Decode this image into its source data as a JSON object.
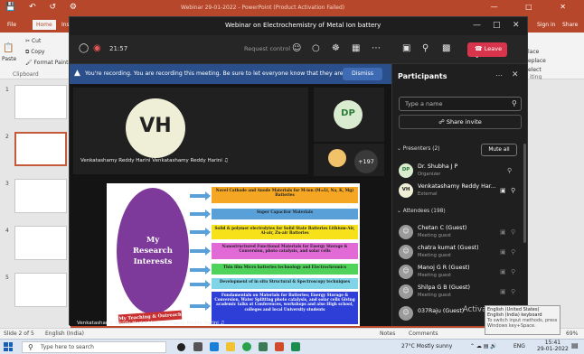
{
  "powerpoint": {
    "title": "Webinar 29-01-2022 - PowerPoint (Product Activation Failed)",
    "tabs": [
      "File",
      "Home",
      "Insert"
    ],
    "sign_in": "Sign in",
    "share": "Share",
    "ribbon": {
      "paste": "Paste",
      "cut": "Cut",
      "copy": "Copy",
      "format_painter": "Format Painter",
      "clipboard": "Clipboard",
      "place": "lace",
      "right_1": "eplace",
      "right_2": "elect",
      "editing": "iting"
    },
    "slide_numbers": [
      "1",
      "2",
      "3",
      "4",
      "5"
    ],
    "status": {
      "slide": "Slide 2 of 5",
      "language": "English (India)",
      "notes": "Notes",
      "comments": "Comments",
      "zoom": "69%"
    }
  },
  "taskbar": {
    "search_placeholder": "Type here to search",
    "weather": "27°C  Mostly sunny",
    "lang": "ENG",
    "time": "15:41",
    "date": "29-01-2022"
  },
  "webex": {
    "window_title": "Webinar on Electrochemistry of Metal Ion battery",
    "elapsed": "21:57",
    "request_control": "Request control",
    "leave_label": "Leave",
    "recording_banner": "You're recording. You are recording this meeting. Be sure to let everyone know that they are ...",
    "dismiss_label": "Dismiss",
    "tile_main_initials": "VH",
    "tile_small_initials": "DP",
    "more_participants": "+197",
    "tile_name": "Venkatashamy Reddy Harini Venkatashamy Reddy Harini",
    "share_name": "Venkatashamy Reddy Harini Venkatashamy Reddy Harini"
  },
  "slide": {
    "oval_lines": [
      "My",
      "Research",
      "Interests"
    ],
    "boxes": [
      {
        "text": "Novel Cathode and Anode Materials for M-ion (M=Li, Na, K, Mg) Batteries",
        "color": "#f5a623"
      },
      {
        "text": "Super Capacitor Materials",
        "color": "#5aa0d8"
      },
      {
        "text": "Solid & polymer electrolytes for Solid State Batteries Lithium-Air, Al-air, Zn-air Batteries",
        "color": "#f7e11b"
      },
      {
        "text": "Nanostructured Functional Materials for Energy Storage & Conversion, photo catalysis, and solar cells",
        "color": "#e26ad6"
      },
      {
        "text": "Thin film Micro batteries technology and Electrochromics",
        "color": "#4fd35a"
      },
      {
        "text": "Development of in situ Structural & Spectroscopy techniques",
        "color": "#7fd4e8"
      },
      {
        "text": "Fundamentals on Materials for Batteries; Energy Storage & Conversion, Water Splitting photo catalysis, and solar cells Giving academic talks at Conferences, workshops and also High school, colleges and local University students",
        "color": "#2d3fd6"
      }
    ],
    "publications_label": "My Teaching & Outreach"
  },
  "participants": {
    "header": "Participants",
    "search_placeholder": "Type a name",
    "share_invite": "Share invite",
    "presenters_label": "Presenters (2)",
    "mute_all": "Mute all",
    "attendees_label": "Attendees (198)",
    "presenters": [
      {
        "initials": "DP",
        "name": "Dr. Shubha J P",
        "role": "Organizer"
      },
      {
        "initials": "VH",
        "name": "Venkatashamy Reddy Har...",
        "role": "External"
      }
    ],
    "attendees": [
      {
        "name": "Chetan C (Guest)",
        "role": "Meeting guest"
      },
      {
        "name": "chatra kumat (Guest)",
        "role": "Meeting guest"
      },
      {
        "name": "Manoj G R (Guest)",
        "role": "Meeting guest"
      },
      {
        "name": "Shilpa G B (Guest)",
        "role": "Meeting guest"
      },
      {
        "name": "037Raju (Guest)",
        "role": ""
      }
    ]
  },
  "windows": {
    "activate": "Activate",
    "lang_tip": [
      "English (United States)",
      "English (India) keyboard",
      "To switch input methods, press",
      "Windows key+Space."
    ]
  }
}
